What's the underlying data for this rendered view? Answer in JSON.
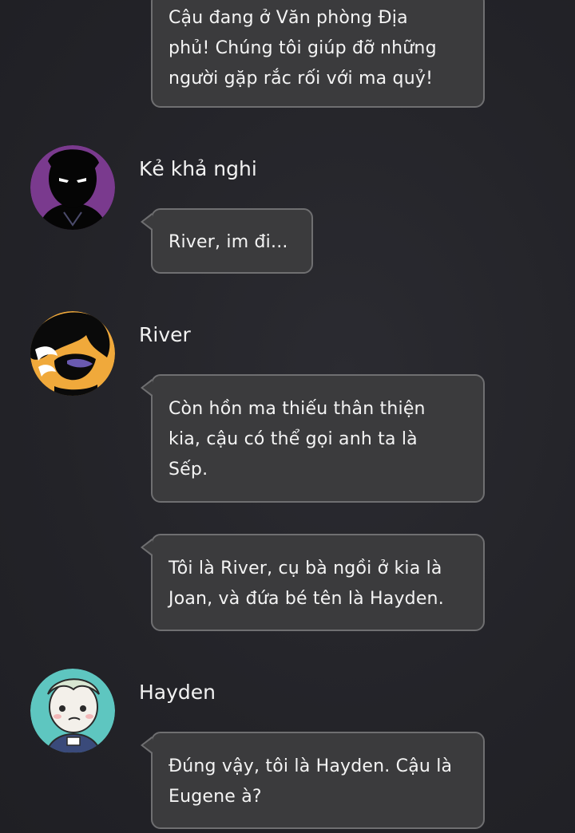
{
  "messages": [
    {
      "text": "Cậu đang ở Văn phòng Địa\nphủ! Chúng tôi giúp đỡ những\nngười gặp rắc rối với ma quỷ!"
    },
    {
      "sender": "Kẻ khả nghi",
      "avatar_icon": "shadow-figure-avatar-icon",
      "avatar_color": "#7a3a8e",
      "text": "River, im đi..."
    },
    {
      "sender": "River",
      "avatar_icon": "river-avatar-icon",
      "avatar_color": "#f0a93b",
      "text": "Còn hồn ma thiếu thân thiện\nkia, cậu có thể gọi anh ta là\nSếp."
    },
    {
      "text": "Tôi là River, cụ bà ngồi ở kia là\nJoan, và đứa bé tên là Hayden."
    },
    {
      "sender": "Hayden",
      "avatar_icon": "hayden-avatar-icon",
      "avatar_color": "#5ec6c0",
      "text": "Đúng vậy, tôi là Hayden. Cậu là\nEugene à?"
    }
  ]
}
